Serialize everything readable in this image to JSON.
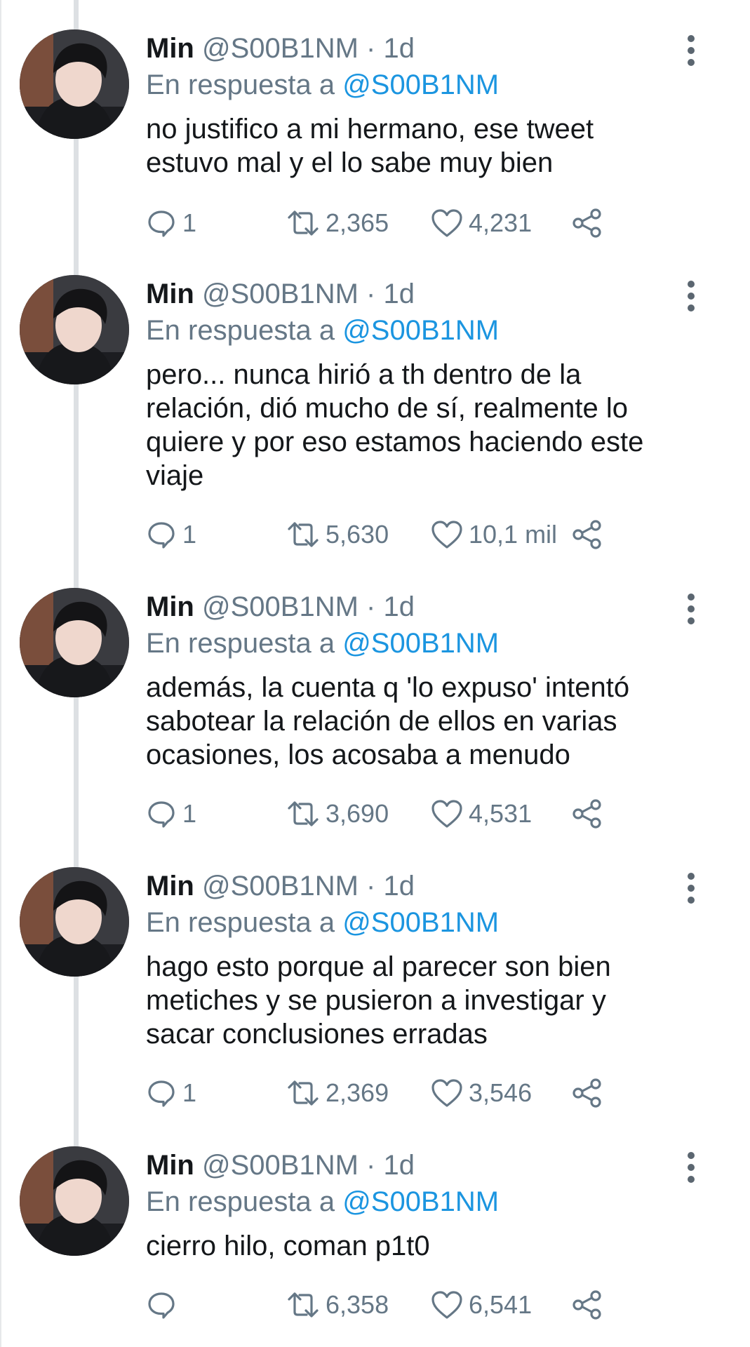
{
  "colors": {
    "text": "#14171a",
    "secondary": "#657786",
    "mention": "#1b95e0",
    "thread_line": "#dde0e3"
  },
  "icons": {
    "reply": "speech-bubble-icon",
    "retweet": "retweet-arrows-icon",
    "like": "heart-icon",
    "share": "share-icon",
    "menu": "vertical-dots-menu-icon"
  },
  "tweets": [
    {
      "name": "Min",
      "handle": "@S00B1NM",
      "separator": "·",
      "time": "1d",
      "reply_prefix": "En respuesta a",
      "reply_to": "@S00B1NM",
      "lines": [
        "no justifico a mi hermano, ese tweet",
        "estuvo mal y el lo sabe muy bien"
      ],
      "replies": "1",
      "retweets": "2,365",
      "likes": "4,231"
    },
    {
      "name": "Min",
      "handle": "@S00B1NM",
      "separator": "·",
      "time": "1d",
      "reply_prefix": "En respuesta a",
      "reply_to": "@S00B1NM",
      "lines": [
        "pero... nunca hirió a th dentro de la",
        "relación, dió mucho de sí, realmente lo",
        "quiere y por eso estamos haciendo este",
        "viaje"
      ],
      "replies": "1",
      "retweets": "5,630",
      "likes": "10,1 mil"
    },
    {
      "name": "Min",
      "handle": "@S00B1NM",
      "separator": "·",
      "time": "1d",
      "reply_prefix": "En respuesta a",
      "reply_to": "@S00B1NM",
      "lines": [
        "además, la cuenta q 'lo expuso' intentó",
        "sabotear la relación de ellos en varias",
        "ocasiones, los acosaba a menudo"
      ],
      "replies": "1",
      "retweets": "3,690",
      "likes": "4,531"
    },
    {
      "name": "Min",
      "handle": "@S00B1NM",
      "separator": "·",
      "time": "1d",
      "reply_prefix": "En respuesta a",
      "reply_to": "@S00B1NM",
      "lines": [
        "hago esto porque al parecer son bien",
        "metiches y se pusieron a investigar y",
        "sacar conclusiones erradas"
      ],
      "replies": "1",
      "retweets": "2,369",
      "likes": "3,546"
    },
    {
      "name": "Min",
      "handle": "@S00B1NM",
      "separator": "·",
      "time": "1d",
      "reply_prefix": "En respuesta a",
      "reply_to": "@S00B1NM",
      "lines": [
        "cierro hilo, coman p1t0"
      ],
      "replies": "",
      "retweets": "6,358",
      "likes": "6,541"
    }
  ]
}
